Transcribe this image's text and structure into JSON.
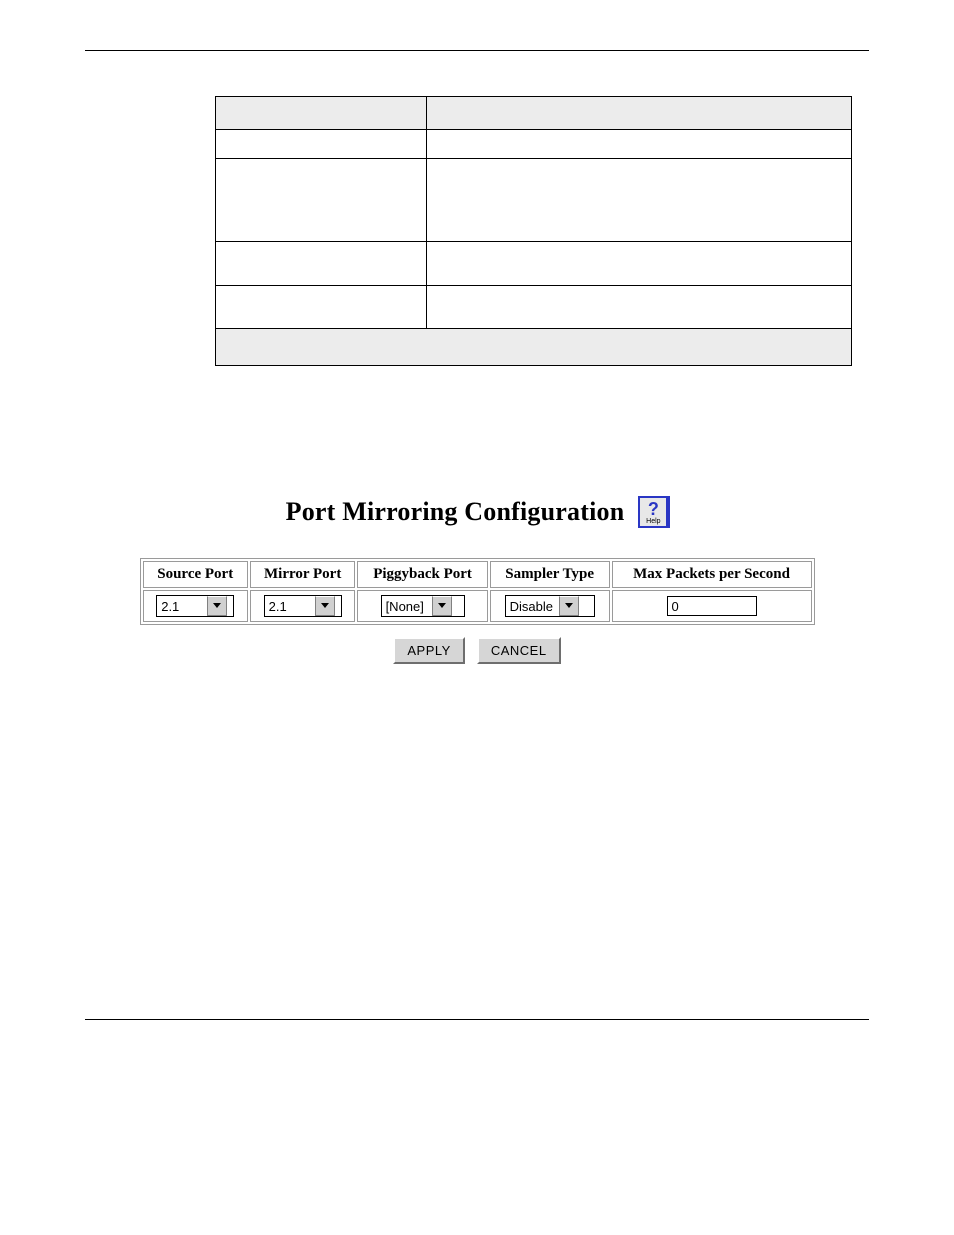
{
  "screenshot": {
    "title": "Port Mirroring Configuration",
    "help_alt": "Help",
    "columns": {
      "source_port": "Source Port",
      "mirror_port": "Mirror Port",
      "piggyback_port": "Piggyback Port",
      "sampler_type": "Sampler Type",
      "max_pps": "Max Packets per Second"
    },
    "values": {
      "source_port": "2.1",
      "mirror_port": "2.1",
      "piggyback_port": "[None]",
      "sampler_type": "Disable",
      "max_pps": "0"
    },
    "buttons": {
      "apply": "APPLY",
      "cancel": "CANCEL"
    }
  }
}
